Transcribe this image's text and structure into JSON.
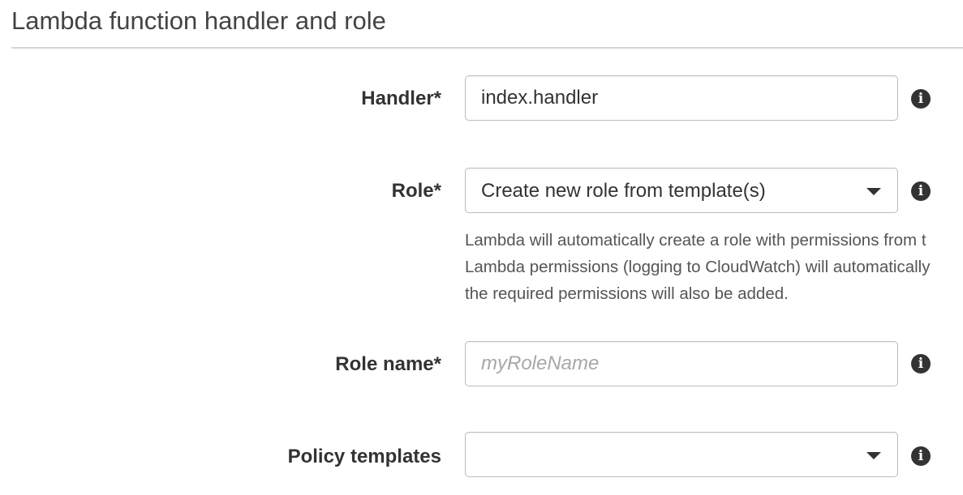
{
  "section": {
    "title": "Lambda function handler and role"
  },
  "handler": {
    "label": "Handler*",
    "value": "index.handler"
  },
  "role": {
    "label": "Role*",
    "selected": "Create new role from template(s)",
    "help_lines": [
      "Lambda will automatically create a role with permissions from t",
      "Lambda permissions (logging to CloudWatch) will automatically",
      "the required permissions will also be added."
    ]
  },
  "role_name": {
    "label": "Role name*",
    "value": "",
    "placeholder": "myRoleName"
  },
  "policy_templates": {
    "label": "Policy templates",
    "selected": ""
  },
  "icons": {
    "info": "info-icon",
    "info_glyph": "i",
    "caret": "chevron-down-icon"
  },
  "colors": {
    "label_text": "#333333",
    "help_text": "#555555",
    "placeholder": "#a7a7a7",
    "field_border": "#bdbdbd",
    "divider": "#d5d5d5"
  }
}
